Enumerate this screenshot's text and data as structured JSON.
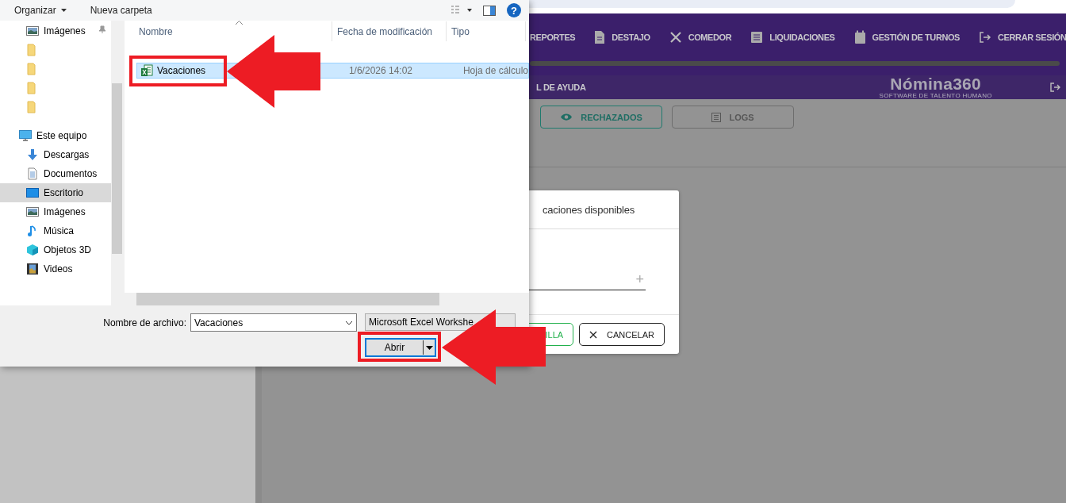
{
  "page": {
    "nav_items": [
      {
        "label": "REPORTES"
      },
      {
        "label": "DESTAJO"
      },
      {
        "label": "COMEDOR"
      },
      {
        "label": "LIQUIDACIONES"
      },
      {
        "label": "GESTIÓN DE TURNOS"
      },
      {
        "label": "CERRAR SESIÓN"
      }
    ],
    "help_link": "L DE AYUDA",
    "logo": {
      "name": "Nómina360",
      "tagline": "SOFTWARE DE TALENTO HUMANO"
    },
    "actions": [
      {
        "label": "RECHAZADOS",
        "kind": "outline-teal"
      },
      {
        "label": "LOGS",
        "kind": "outline-grey"
      }
    ],
    "modal": {
      "title": "caciones disponibles",
      "add": "+",
      "buttons": [
        {
          "label": "ILLA",
          "kind": "template"
        },
        {
          "label": "CANCELAR",
          "kind": "cancel"
        }
      ]
    }
  },
  "file_dialog": {
    "toolbar": [
      {
        "label": "Organizar",
        "kind": "menu"
      },
      {
        "label": "Nueva carpeta",
        "kind": "plain"
      }
    ],
    "help": "?",
    "nav_items": [
      {
        "label": "Imágenes",
        "kind": "pictures",
        "pinned": true,
        "selected": false
      },
      {
        "kind": "folder",
        "pinned": false,
        "selected": false
      },
      {
        "kind": "folder",
        "pinned": false,
        "selected": false
      },
      {
        "kind": "folder",
        "pinned": false,
        "selected": false
      },
      {
        "kind": "folder",
        "pinned": false,
        "selected": false
      },
      {
        "label": "Este equipo",
        "kind": "computer",
        "pinned": false,
        "selected": false,
        "children": [
          {
            "label": "Descargas",
            "kind": "downloads",
            "selected": false
          },
          {
            "label": "Documentos",
            "kind": "documents",
            "selected": false
          },
          {
            "label": "Escritorio",
            "kind": "desktop",
            "selected": true
          },
          {
            "label": "Imágenes",
            "kind": "pictures",
            "selected": false
          },
          {
            "label": "Música",
            "kind": "music",
            "selected": false
          },
          {
            "label": "Objetos 3D",
            "kind": "objects3d",
            "selected": false
          },
          {
            "label": "Videos",
            "kind": "videos",
            "selected": false
          }
        ]
      }
    ],
    "columns": [
      "Nombre",
      "Fecha de modificación",
      "Tipo"
    ],
    "files": [
      {
        "name": "Vacaciones",
        "modified": "1/6/2026 14:02",
        "type": "Hoja de cálculo",
        "selected": true,
        "highlighted": true
      }
    ],
    "file_name_label": "Nombre de archivo:",
    "file_name": "Vacaciones",
    "file_type": "Microsoft Excel Workshe",
    "open_button": {
      "label": "Abrir",
      "highlighted": true
    }
  }
}
